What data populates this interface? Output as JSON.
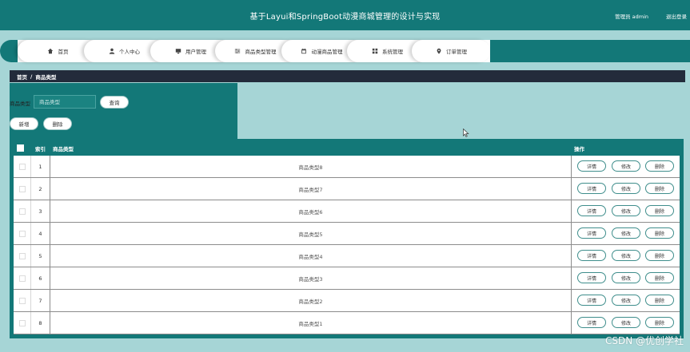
{
  "header": {
    "title": "基于Layui和SpringBoot动漫商城管理的设计与实现",
    "user_label": "管理员 admin",
    "logout_label": "退出登录"
  },
  "nav": {
    "tabs": [
      {
        "label": "首页",
        "icon": "home-icon"
      },
      {
        "label": "个人中心",
        "icon": "user-icon"
      },
      {
        "label": "用户管理",
        "icon": "monitor-icon"
      },
      {
        "label": "商品类型管理",
        "icon": "sliders-icon"
      },
      {
        "label": "动漫商品管理",
        "icon": "calendar-icon"
      },
      {
        "label": "系统管理",
        "icon": "grid-icon"
      },
      {
        "label": "订单管理",
        "icon": "pin-icon"
      }
    ]
  },
  "breadcrumb": {
    "home": "首页",
    "separator": "/",
    "current": "商品类型"
  },
  "search": {
    "label": "商品类型",
    "placeholder": "商品类型",
    "button": "查询"
  },
  "actions": {
    "add": "新增",
    "delete": "删除"
  },
  "table": {
    "headers": {
      "index": "索引",
      "name": "商品类型",
      "ops": "操作"
    },
    "ops": {
      "detail": "详情",
      "edit": "修改",
      "delete": "删除"
    },
    "rows": [
      {
        "index": "1",
        "name": "商品类型8"
      },
      {
        "index": "2",
        "name": "商品类型7"
      },
      {
        "index": "3",
        "name": "商品类型6"
      },
      {
        "index": "4",
        "name": "商品类型5"
      },
      {
        "index": "5",
        "name": "商品类型4"
      },
      {
        "index": "6",
        "name": "商品类型3"
      },
      {
        "index": "7",
        "name": "商品类型2"
      },
      {
        "index": "8",
        "name": "商品类型1"
      }
    ]
  },
  "watermark": "CSDN @优创学社",
  "colors": {
    "primary": "#137878",
    "background": "#a6d5d6",
    "breadcrumb": "#232b3b"
  }
}
